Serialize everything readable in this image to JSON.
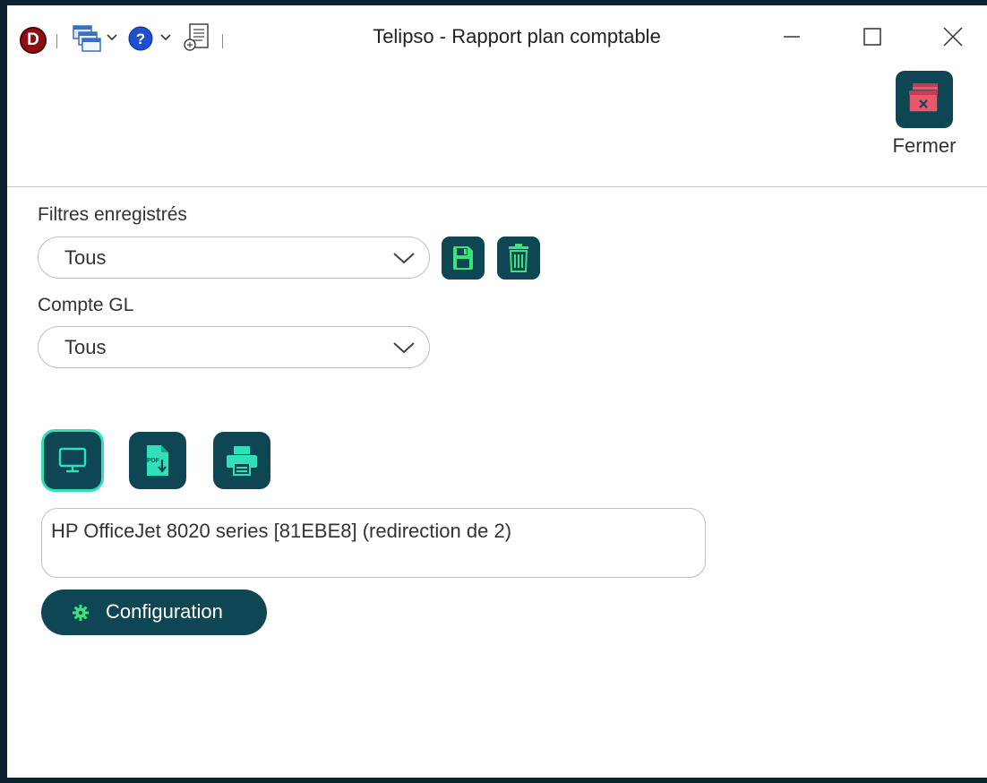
{
  "window": {
    "title": "Telipso - Rapport plan comptable",
    "logo_letter": "D",
    "quick_access_icons": [
      "windows-icon",
      "help-icon",
      "document-icon"
    ]
  },
  "toolbar": {
    "close_label": "Fermer",
    "close_icon": "window-close-icon"
  },
  "filters": {
    "saved_label": "Filtres enregistrés",
    "saved_value": "Tous",
    "gl_label": "Compte GL",
    "gl_value": "Tous"
  },
  "output": {
    "modes": [
      "screen-icon",
      "pdf-export-icon",
      "printer-icon"
    ],
    "selected_mode": "screen-icon",
    "printer_name": "HP OfficeJet 8020 series [81EBE8] (redirection de 2)",
    "config_label": "Configuration"
  },
  "colors": {
    "button_bg": "#0e4654",
    "icon_green": "#3de37a",
    "icon_teal": "#2fe0b8",
    "close_icon_red": "#e8576a",
    "frame": "#0b2230"
  }
}
